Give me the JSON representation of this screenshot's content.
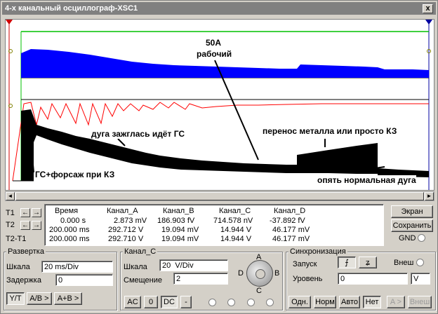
{
  "window": {
    "title": "4-х канальный осциллограф-XSC1",
    "close_label": "x"
  },
  "annotations": {
    "rated_current": "50A",
    "working": "рабочий",
    "arc_ignited": "дуга зажглась идёт ГС",
    "metal_transfer": "перенос металла или просто КЗ",
    "normal_arc": "опять нормальная дуга",
    "hot_start": "ГС+форсаж при КЗ"
  },
  "cursors": {
    "t1": "T1",
    "t2": "T2",
    "t2_t1": "T2-T1",
    "t1_marker": "1",
    "t2_marker": "2"
  },
  "readout": {
    "headers": [
      "Время",
      "Канал_A",
      "Канал_B",
      "Канал_C",
      "Канал_D"
    ],
    "rows": [
      [
        "0.000 s",
        "2.873 mV",
        "186.903 fV",
        "714.578 nV",
        "-37.892 fV"
      ],
      [
        "200.000 ms",
        "292.712 V",
        "19.094 mV",
        "14.944 V",
        "46.177 mV"
      ],
      [
        "200.000 ms",
        "292.710 V",
        "19.094 mV",
        "14.944 V",
        "46.177 mV"
      ]
    ]
  },
  "right_buttons": {
    "screen": "Экран",
    "save": "Сохранить",
    "gnd": "GND"
  },
  "timebase": {
    "title": "Развертка",
    "scale_label": "Шкала",
    "scale_value": "20 ms/Div",
    "delay_label": "Задержка",
    "delay_value": "0",
    "mode_yt": "Y/T",
    "mode_ab": "A/B >",
    "mode_apb": "A+B >"
  },
  "channel": {
    "title": "Канал_C",
    "scale_label": "Шкала",
    "scale_value": "20  V/Div",
    "offset_label": "Смещение",
    "offset_value": "2",
    "ac": "AC",
    "zero": "0",
    "dc": "DC",
    "minus": "-",
    "selector": {
      "a": "A",
      "b": "B",
      "c": "C",
      "d": "D"
    }
  },
  "trigger": {
    "title": "Синхронизация",
    "start_label": "Запуск",
    "ext_label": "Внеш",
    "level_label": "Уровень",
    "level_value": "0",
    "level_unit": "V",
    "single": "Одн.",
    "normal": "Норм",
    "auto": "Авто",
    "none": "Нет",
    "a_gt": "A >",
    "ext_btn": "Внеш"
  },
  "chart_data": {
    "type": "line",
    "title": "",
    "xlabel": "",
    "ylabel": "",
    "x_range_ms": [
      0,
      200
    ],
    "colors": {
      "channel_a": "#0000ff",
      "channel_b": "#ff0000",
      "channel_c": "#000000",
      "channel_d": "#00c000"
    },
    "series": [
      {
        "name": "Канал_A",
        "note": "blue filled envelope, high at start then slowly decaying, rising again after ~150 ms"
      },
      {
        "name": "Канал_B",
        "note": "red sawtooth with ~15 periods over the first ~115 ms"
      },
      {
        "name": "Канал_C",
        "note": "black thick envelope decaying from start, jump at ~150 ms then ramp, drop at ~193 ms"
      },
      {
        "name": "Канал_D",
        "note": "green flat trace at top"
      }
    ]
  }
}
